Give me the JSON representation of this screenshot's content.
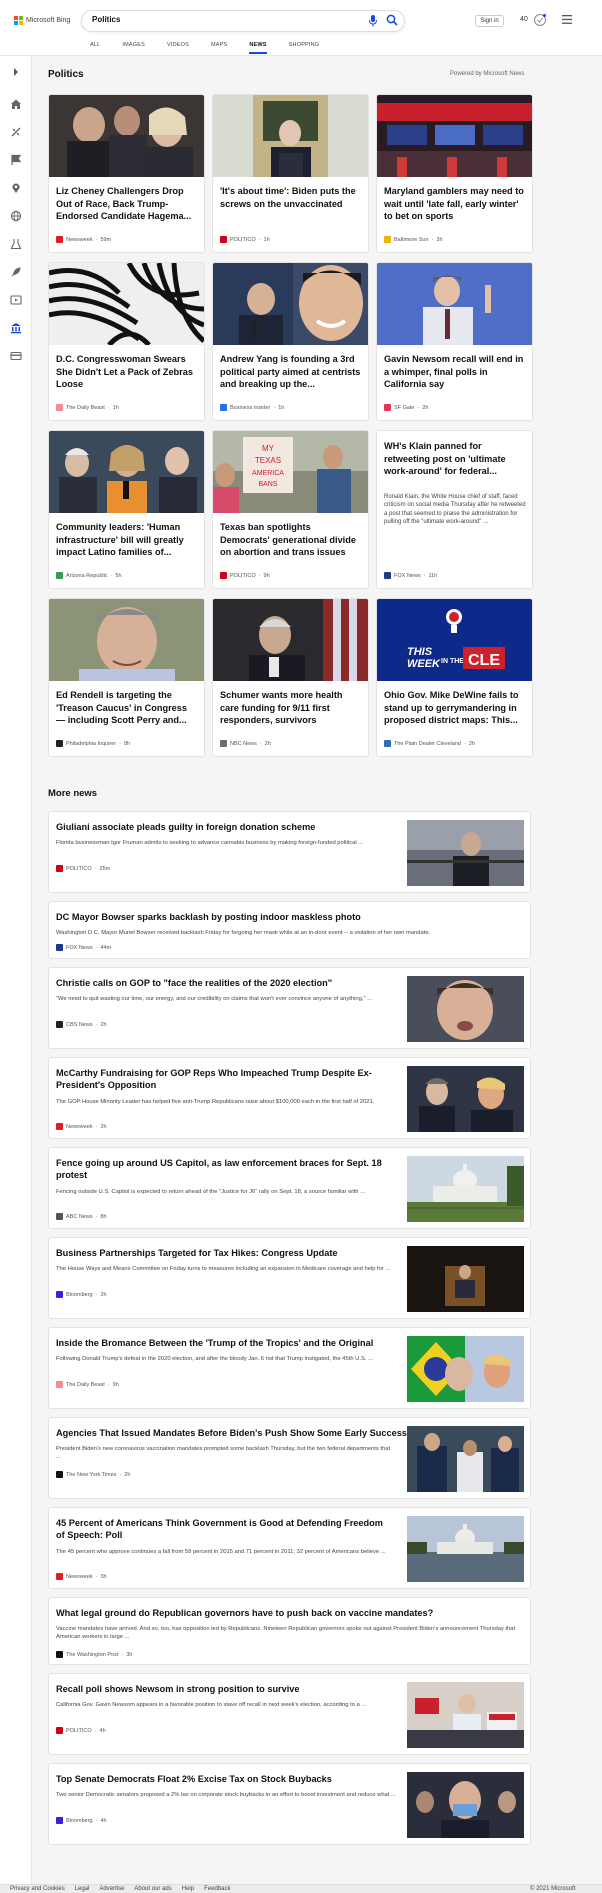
{
  "brand": {
    "name": "Microsoft Bing",
    "colors": [
      "#f25022",
      "#7fba00",
      "#00a4ef",
      "#ffb900"
    ]
  },
  "search": {
    "query": "Politics"
  },
  "header": {
    "signin": "Sign in",
    "points": "40"
  },
  "tabs": [
    "ALL",
    "IMAGES",
    "VIDEOS",
    "MAPS",
    "NEWS",
    "SHOPPING"
  ],
  "rail_icons": [
    "home-icon",
    "sports-icon",
    "flag-icon",
    "location-icon",
    "globe-icon",
    "science-icon",
    "rocket-icon",
    "video-icon",
    "bank-icon",
    "card-icon"
  ],
  "page": {
    "title": "Politics",
    "powered": "Powered by Microsoft News"
  },
  "cards": [
    {
      "title": "Liz Cheney Challengers Drop Out of Race, Back Trump-Endorsed Candidate Hagema...",
      "source": "Newsweek",
      "time": "59m",
      "favicon": "#e01c24"
    },
    {
      "title": "'It's about time': Biden puts the screws on the unvaccinated",
      "source": "POLITICO",
      "time": "1h",
      "favicon": "#d0021b"
    },
    {
      "title": "Maryland gamblers may need to wait until 'late fall, early winter' to bet on sports",
      "source": "Baltimore Sun",
      "time": "3h",
      "favicon": "#f0b400"
    },
    {
      "title": "D.C. Congresswoman Swears She Didn't Let a Pack of Zebras Loose",
      "source": "The Daily Beast",
      "time": "1h",
      "favicon": "#f28b94"
    },
    {
      "title": "Andrew Yang is founding a 3rd political party aimed at centrists and breaking up the...",
      "source": "Business Insider",
      "time": "1h",
      "favicon": "#2a6ef0"
    },
    {
      "title": "Gavin Newsom recall will end in a whimper, final polls in California say",
      "source": "SF Gate",
      "time": "2h",
      "favicon": "#e8315b"
    },
    {
      "title": "Community leaders: 'Human infrastructure' bill will greatly impact Latino families of...",
      "source": "Arizona Republic",
      "time": "5h",
      "favicon": "#3a9a5b"
    },
    {
      "title": "Texas ban spotlights Democrats' generational divide on abortion and trans issues",
      "source": "POLITICO",
      "time": "9h",
      "favicon": "#d0021b"
    },
    {
      "title": "WH's Klain panned for retweeting post on 'ultimate work-around' for federal...",
      "snippet": "Ronald Klain, the White House chief of staff, faced criticism on social media Thursday after he retweeted a post that seemed to praise the administration for pulling off the \"ultimate work-around\" ...",
      "source": "FOX News",
      "time": "11h",
      "favicon": "#1a3a8a"
    },
    {
      "title": "Ed Rendell is targeting the 'Treason Caucus' in Congress — including Scott Perry and...",
      "source": "Philadelphia Inquirer",
      "time": "8h",
      "favicon": "#222222"
    },
    {
      "title": "Schumer wants more health care funding for 9/11 first responders, survivors",
      "source": "NBC News",
      "time": "2h",
      "favicon": "#6e6e6e"
    },
    {
      "title": "Ohio Gov. Mike DeWine fails to stand up to gerrymandering in proposed district maps: This...",
      "source": "The Plain Dealer Cleveland",
      "time": "2h",
      "favicon": "#2f6fb5",
      "image_text": [
        "THIS",
        "WEEK",
        "IN THE",
        "CLE"
      ]
    }
  ],
  "more_news_title": "More news",
  "more_news": [
    {
      "title": "Giuliani associate pleads guilty in foreign donation scheme",
      "snippet": "Florida businessman Igor Fruman admits to seeking to advance cannabis business by making foreign-funded political ...",
      "source": "POLITICO",
      "time": "25m",
      "favicon": "#d0021b",
      "has_image": true
    },
    {
      "title": "DC Mayor Bowser sparks backlash by posting indoor maskless photo",
      "snippet": "Washington D.C. Mayor Muriel Bowser received backlash Friday for forgoing her mask while at an in-door event -- a violation of her own mandate.",
      "source": "FOX News",
      "time": "44m",
      "favicon": "#1a3a8a",
      "has_image": false
    },
    {
      "title": "Christie calls on GOP to \"face the realities of the 2020 election\"",
      "snippet": "\"We need to quit wasting our time, our energy, and our credibility on claims that won't ever convince anyone of anything,\" ...",
      "source": "CBS News",
      "time": "2h",
      "favicon": "#222222",
      "has_image": true
    },
    {
      "title": "McCarthy Fundraising for GOP Reps Who Impeached Trump Despite Ex-President's Opposition",
      "snippet": "The GOP House Minority Leader has helped five anti-Trump Republicans raise about $100,000 each in the first half of 2021.",
      "source": "Newsweek",
      "time": "2h",
      "favicon": "#e01c24",
      "has_image": true
    },
    {
      "title": "Fence going up around US Capitol, as law enforcement braces for Sept. 18 protest",
      "snippet": "Fencing outside U.S. Capitol is expected to return ahead of the \"Justice for J6\" rally on Sept. 18, a source familiar with ...",
      "source": "ABC News",
      "time": "8h",
      "favicon": "#555555",
      "has_image": true
    },
    {
      "title": "Business Partnerships Targeted for Tax Hikes: Congress Update",
      "snippet": "The House Ways and Means Committee on Friday turns to measures including an expansion in Medicare coverage and help for ...",
      "source": "Bloomberg",
      "time": "2h",
      "favicon": "#3b1fd9",
      "has_image": true
    },
    {
      "title": "Inside the Bromance Between the 'Trump of the Tropics' and the Original",
      "snippet": "Following Donald Trump's defeat in the 2020 election, and after the bloody Jan. 6 riot that Trump instigated, the 45th U.S. ...",
      "source": "The Daily Beast",
      "time": "9h",
      "favicon": "#f28b94",
      "has_image": true
    },
    {
      "title": "Agencies That Issued Mandates Before Biden's Push Show Some Early Success",
      "snippet": "President Biden's new coronavirus vaccination mandates prompted some backlash Thursday, but the two federal departments that ...",
      "source": "The New York Times",
      "time": "2h",
      "favicon": "#111111",
      "has_image": true
    },
    {
      "title": "45 Percent of Americans Think Government is Good at Defending Freedom of Speech: Poll",
      "snippet": "The 45 percent who approve continues a fall from 59 percent in 2015 and 71 percent in 2011; 32 percent of Americans believe ...",
      "source": "Newsweek",
      "time": "3h",
      "favicon": "#e01c24",
      "has_image": true
    },
    {
      "title": "What legal ground do Republican governors have to push back on vaccine mandates?",
      "snippet": "Vaccine mandates have arrived. And so, too, has opposition led by Republicans. Nineteen Republican governors spoke out against President Biden's announcement Thursday that American workers in large ...",
      "source": "The Washington Post",
      "time": "3h",
      "favicon": "#111111",
      "has_image": false
    },
    {
      "title": "Recall poll shows Newsom in strong position to survive",
      "snippet": "California Gov. Gavin Newsom appears in a favorable position to stave off recall in next week's election, according to a ...",
      "source": "POLITICO",
      "time": "4h",
      "favicon": "#d0021b",
      "has_image": true
    },
    {
      "title": "Top Senate Democrats Float 2% Excise Tax on Stock Buybacks",
      "snippet": "Two senior Democratic senators proposed a 2% tax on corporate stock buybacks in an effort to boost investment and reduce what ...",
      "source": "Bloomberg",
      "time": "4h",
      "favicon": "#3b1fd9",
      "has_image": true
    }
  ],
  "footer": {
    "links": [
      "Privacy and Cookies",
      "Legal",
      "Advertise",
      "About our ads",
      "Help",
      "Feedback"
    ],
    "copyright": "© 2021 Microsoft"
  }
}
